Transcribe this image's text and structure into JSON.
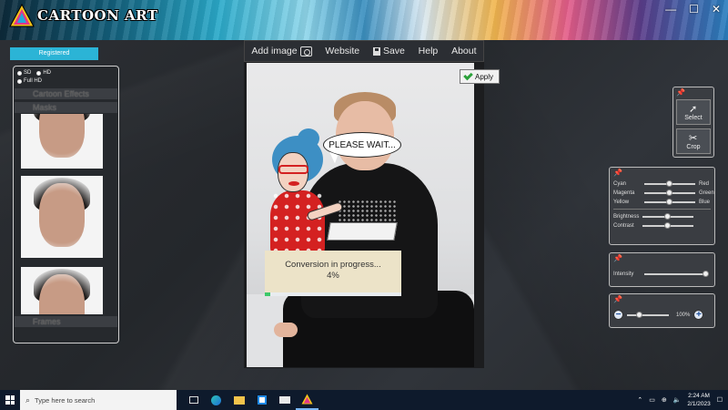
{
  "app": {
    "logo_text": "CARTOON ART",
    "window_buttons": {
      "minimize": "—",
      "maximize": "☐",
      "close": "✕"
    }
  },
  "menu": {
    "items": [
      {
        "label": "Add image",
        "icon": "camera-icon"
      },
      {
        "label": "Website"
      },
      {
        "label": "Save",
        "icon": "save-icon"
      },
      {
        "label": "Help"
      },
      {
        "label": "About"
      }
    ]
  },
  "left_panel": {
    "registered": "Registered",
    "resolution": {
      "sd": "SD",
      "hd": "HD",
      "full_hd": "Full HD",
      "selected": "SD"
    },
    "sections": [
      "Cartoon Effects",
      "Masks",
      "Frames"
    ]
  },
  "canvas": {
    "speech_bubble": "PLEASE WAIT...",
    "progress_text": "Conversion in progress...",
    "progress_percent": "4%",
    "progress_value": 0.04
  },
  "apply_button": "Apply",
  "tools": {
    "select": "Select",
    "crop": "Crop"
  },
  "color_adjust": {
    "rows": [
      {
        "left": "Cyan",
        "right": "Red",
        "value": 0.5
      },
      {
        "left": "Magenta",
        "right": "Green",
        "value": 0.5
      },
      {
        "left": "Yellow",
        "right": "Blue",
        "value": 0.5
      }
    ],
    "brightness": {
      "label": "Brightness",
      "value": 0.5
    },
    "contrast": {
      "label": "Contrast",
      "value": 0.5
    }
  },
  "intensity": {
    "label": "Intensity",
    "value": 1.0
  },
  "zoom": {
    "label": "100%",
    "value": 0.3
  },
  "taskbar": {
    "search_placeholder": "Type here to search",
    "time": "2:24 AM",
    "date": "2/1/2023"
  }
}
